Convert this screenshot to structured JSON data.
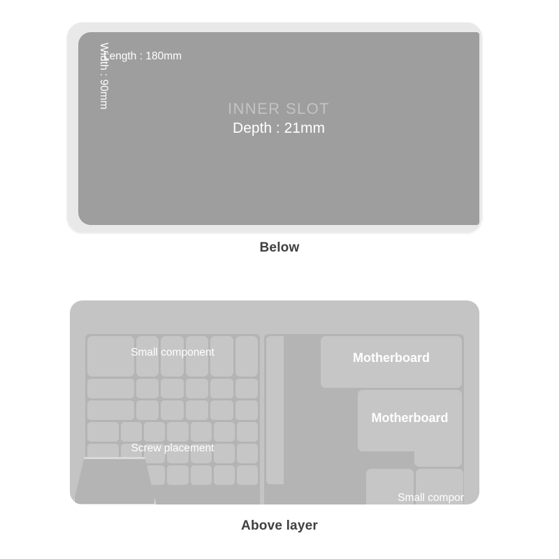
{
  "panels": {
    "below": {
      "caption": "Below",
      "slot": {
        "title": "INNER SLOT",
        "depth": "Depth : 21mm",
        "length": "Length : 180mm",
        "width": "Width : 90mm"
      },
      "colors": {
        "frame": "#e9e9e9",
        "slot_fill": "#9e9e9e",
        "title_text": "#c3c3c3",
        "label_text": "#ffffff"
      }
    },
    "above": {
      "caption": "Above layer",
      "labels": {
        "small_component_left": "Small component",
        "screw_placement": "Screw placement",
        "motherboard_upper": "Motherboard",
        "motherboard_lower": "Motherboard",
        "small_component_right": "Small component"
      },
      "colors": {
        "panel_bg": "#c4c4c4",
        "zone_bg": "#b4b4b4",
        "cell_fill": "#c6c6c6",
        "label_text": "#ffffff"
      }
    }
  },
  "grid": {
    "rows": [
      {
        "name": "small-component-row",
        "cells": 7,
        "tall": true
      },
      {
        "name": "key-row-1",
        "cells": 7
      },
      {
        "name": "key-row-2",
        "cells": 7
      },
      {
        "name": "key-row-3",
        "cells": 7
      },
      {
        "name": "key-row-4",
        "cells": 7
      },
      {
        "name": "key-row-5",
        "cells": 7
      }
    ]
  }
}
